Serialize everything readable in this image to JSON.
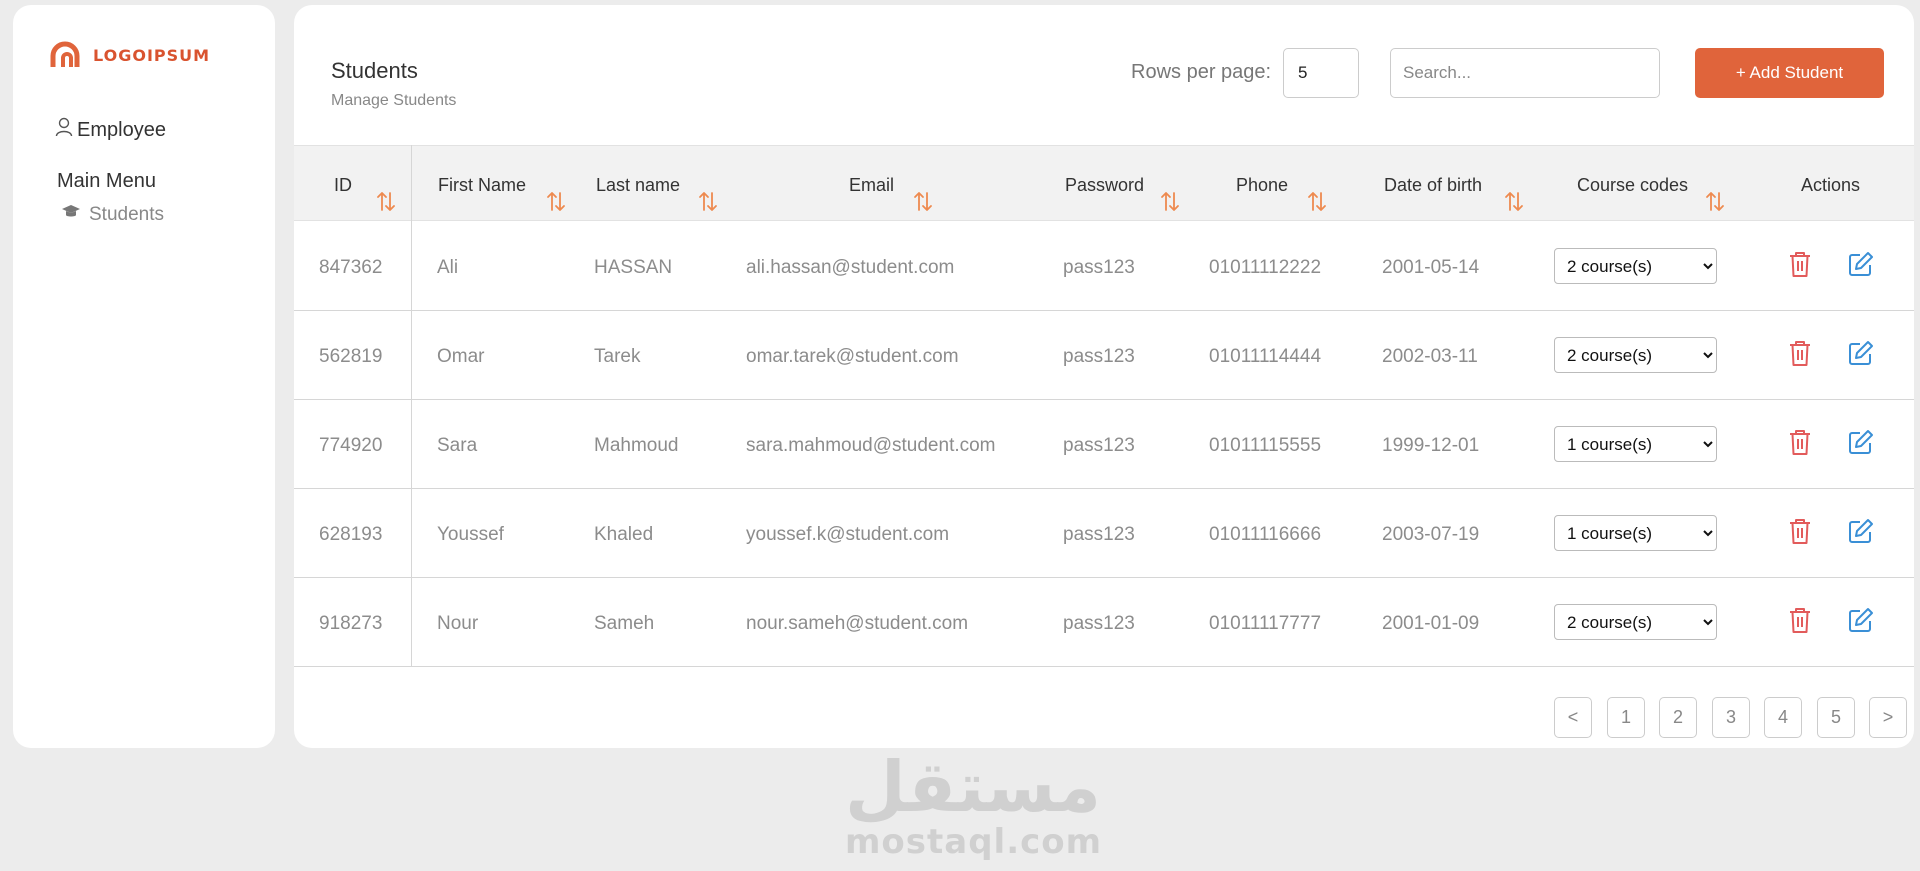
{
  "brand": {
    "name": "LOGOIPSUM",
    "accent": "#e0643b"
  },
  "sidebar": {
    "employee_label": "Employee",
    "menu_title": "Main Menu",
    "items": [
      {
        "label": "Students",
        "icon": "graduation-cap-icon"
      }
    ]
  },
  "header": {
    "title": "Students",
    "subtitle": "Manage Students",
    "rows_per_page_label": "Rows per page:",
    "rows_per_page_value": "5",
    "search_placeholder": "Search...",
    "add_button_label": "+ Add Student"
  },
  "table": {
    "columns": [
      "ID",
      "First Name",
      "Last name",
      "Email",
      "Password",
      "Phone",
      "Date of birth",
      "Course codes",
      "Actions"
    ],
    "rows": [
      {
        "id": "847362",
        "first": "Ali",
        "last": "HASSAN",
        "email": "ali.hassan@student.com",
        "password": "pass123",
        "phone": "01011112222",
        "dob": "2001-05-14",
        "courses": "2 course(s)"
      },
      {
        "id": "562819",
        "first": "Omar",
        "last": "Tarek",
        "email": "omar.tarek@student.com",
        "password": "pass123",
        "phone": "01011114444",
        "dob": "2002-03-11",
        "courses": "2 course(s)"
      },
      {
        "id": "774920",
        "first": "Sara",
        "last": "Mahmoud",
        "email": "sara.mahmoud@student.com",
        "password": "pass123",
        "phone": "01011115555",
        "dob": "1999-12-01",
        "courses": "1 course(s)"
      },
      {
        "id": "628193",
        "first": "Youssef",
        "last": "Khaled",
        "email": "youssef.k@student.com",
        "password": "pass123",
        "phone": "01011116666",
        "dob": "2003-07-19",
        "courses": "1 course(s)"
      },
      {
        "id": "918273",
        "first": "Nour",
        "last": "Sameh",
        "email": "nour.sameh@student.com",
        "password": "pass123",
        "phone": "01011117777",
        "dob": "2001-01-09",
        "courses": "2 course(s)"
      }
    ]
  },
  "pagination": {
    "prev": "<",
    "pages": [
      "1",
      "2",
      "3",
      "4",
      "5"
    ],
    "next": ">"
  },
  "watermark": {
    "arabic": "مستقل",
    "latin": "mostaql.com"
  }
}
